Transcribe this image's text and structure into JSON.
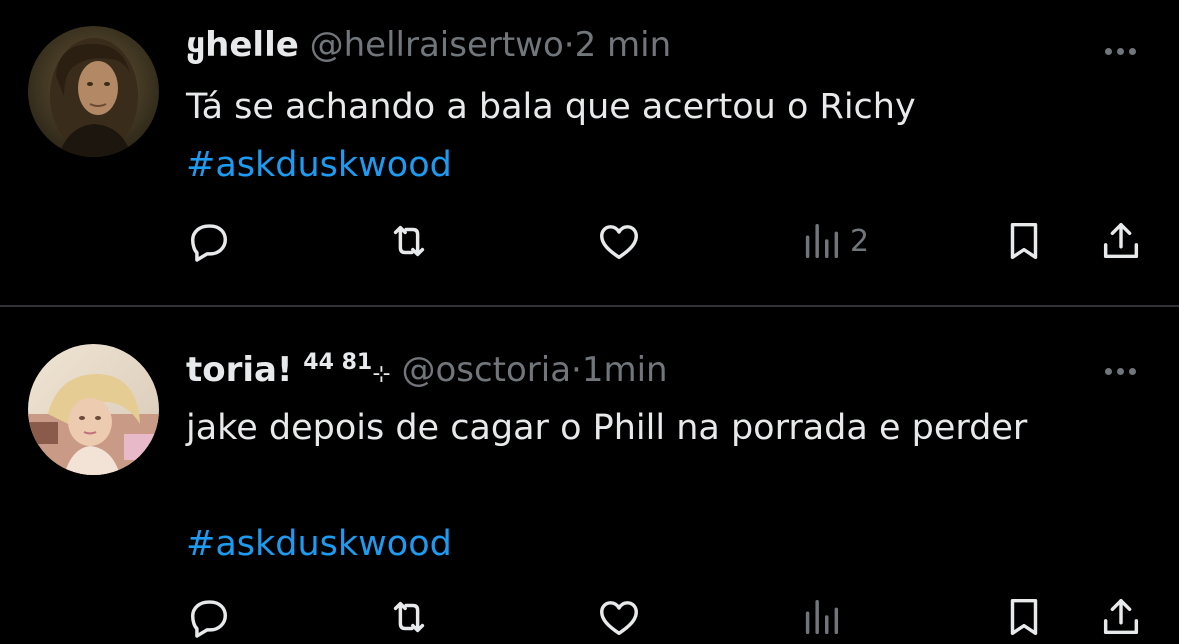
{
  "colors": {
    "background": "#000000",
    "text": "#e7e9ea",
    "muted": "#71767b",
    "hashtag": "#1d9bf0",
    "divider": "#2f3336"
  },
  "tweets": [
    {
      "display_name": "ყhelle",
      "handle": "@hellraisertwo",
      "separator": "·",
      "time": "2 min",
      "text_line_1": "Tá se achando a bala que acertou o Richy",
      "hashtag": "#askduskwood",
      "views": "2",
      "avatar_icon": "avatar-photo-long-haired-man",
      "more_icon": "more-dots-icon"
    },
    {
      "display_name": "toria!",
      "name_superscript": "44 81",
      "name_sparkle": "⊹",
      "handle": "@osctoria",
      "separator": "·",
      "time": "1min",
      "text_line_1": "jake depois de cagar o Phill na porrada e perder",
      "hashtag": "#askduskwood",
      "views": "",
      "avatar_icon": "avatar-photo-blonde-woman",
      "more_icon": "more-dots-icon"
    }
  ],
  "actions": [
    "reply-icon",
    "retweet-icon",
    "like-icon",
    "views-icon",
    "bookmark-icon",
    "share-icon"
  ]
}
